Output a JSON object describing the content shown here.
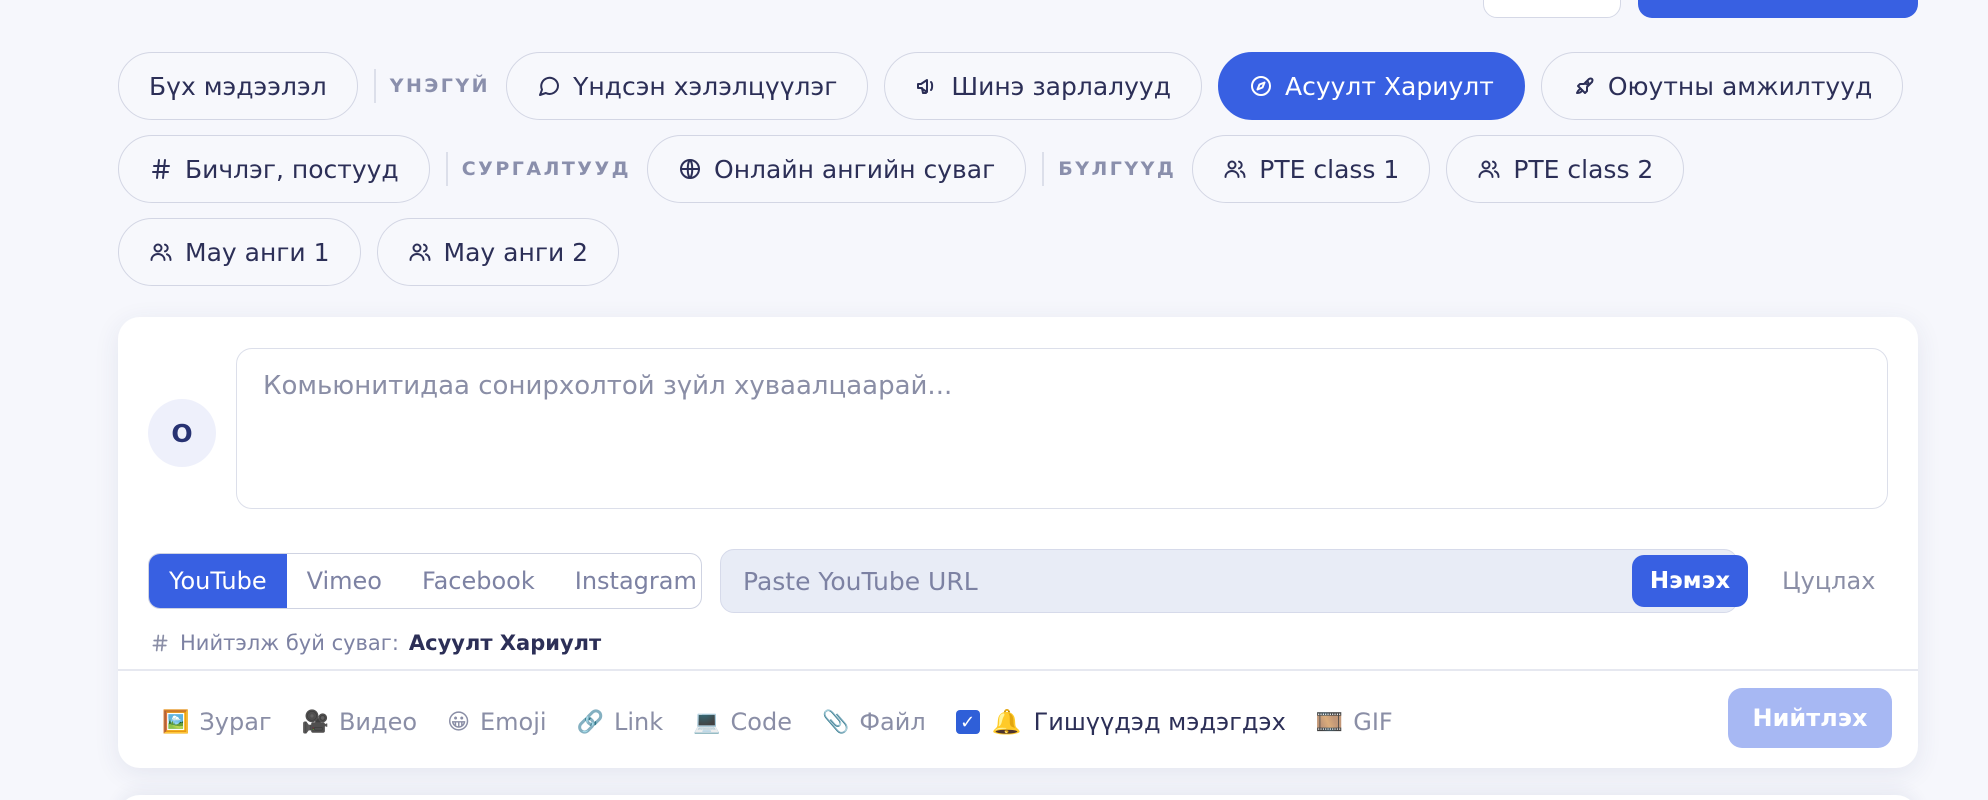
{
  "channels": {
    "all": "Бүх мэдээлэл",
    "groups": [
      {
        "label": "ҮНЭГҮЙ",
        "items": [
          {
            "label": "Үндсэн хэлэлцүүлэг",
            "icon": "chat-bubble-icon"
          },
          {
            "label": "Шинэ зарлалууд",
            "icon": "megaphone-icon"
          },
          {
            "label": "Асуулт Хариулт",
            "icon": "compass-icon",
            "active": true
          },
          {
            "label": "Оюутны амжилтууд",
            "icon": "rocket-icon"
          },
          {
            "label": "Бичлэг, постууд",
            "icon": "hash-icon"
          }
        ]
      },
      {
        "label": "СУРГАЛТУУД",
        "items": [
          {
            "label": "Онлайн ангийн суваг",
            "icon": "globe-icon"
          }
        ]
      },
      {
        "label": "БҮЛГҮҮД",
        "items": [
          {
            "label": "PTE class 1",
            "icon": "users-icon"
          },
          {
            "label": "PTE class 2",
            "icon": "users-icon"
          },
          {
            "label": "May анги 1",
            "icon": "users-icon"
          },
          {
            "label": "May анги 2",
            "icon": "users-icon"
          }
        ]
      }
    ]
  },
  "composer": {
    "avatar_initial": "O",
    "placeholder": "Комьюнитидаа сонирхолтой зүйл хуваалцаарай...",
    "video_sources": [
      "YouTube",
      "Vimeo",
      "Facebook",
      "Instagram"
    ],
    "active_source": "YouTube",
    "url_placeholder": "Paste YouTube URL",
    "add_label": "Нэмэх",
    "cancel_label": "Цуцлах",
    "posting_in_label": "Нийтэлж буй суваг:",
    "posting_in_channel": "Асуулт Хариулт",
    "tools": [
      {
        "emoji": "🖼️",
        "label": "Зураг",
        "name": "image-tool"
      },
      {
        "emoji": "🎥",
        "label": "Видео",
        "name": "video-tool"
      },
      {
        "emoji": "😀",
        "label": "Emoji",
        "name": "emoji-tool"
      },
      {
        "emoji": "🔗",
        "label": "Link",
        "name": "link-tool"
      },
      {
        "emoji": "💻",
        "label": "Code",
        "name": "code-tool"
      },
      {
        "emoji": "📎",
        "label": "Файл",
        "name": "file-tool"
      }
    ],
    "notify_label": "Гишүүдэд мэдэгдэх",
    "notify_checked": true,
    "gif_label": "GIF",
    "publish_label": "Нийтлэх"
  },
  "colors": {
    "accent": "#3860e2",
    "accent_disabled": "#a7b8f3"
  }
}
